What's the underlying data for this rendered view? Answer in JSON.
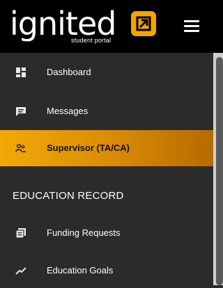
{
  "brand": {
    "name": "ignited",
    "tagline": "student portal",
    "accent": "#f5a300"
  },
  "header": {
    "menu_icon": "hamburger-icon"
  },
  "nav": {
    "items": [
      {
        "label": "Dashboard",
        "icon": "dashboard-icon"
      },
      {
        "label": "Messages",
        "icon": "message-icon"
      },
      {
        "label": "Supervisor (TA/CA)",
        "icon": "supervisor-icon",
        "active": true
      }
    ],
    "section_title": "EDUCATION RECORD",
    "section_items": [
      {
        "label": "Funding Requests",
        "icon": "funding-icon"
      },
      {
        "label": "Education Goals",
        "icon": "trend-icon"
      }
    ]
  },
  "colors": {
    "active_bg": "#e89a05",
    "sidebar_bg": "#2b2b2b",
    "header_bg": "#000000"
  }
}
